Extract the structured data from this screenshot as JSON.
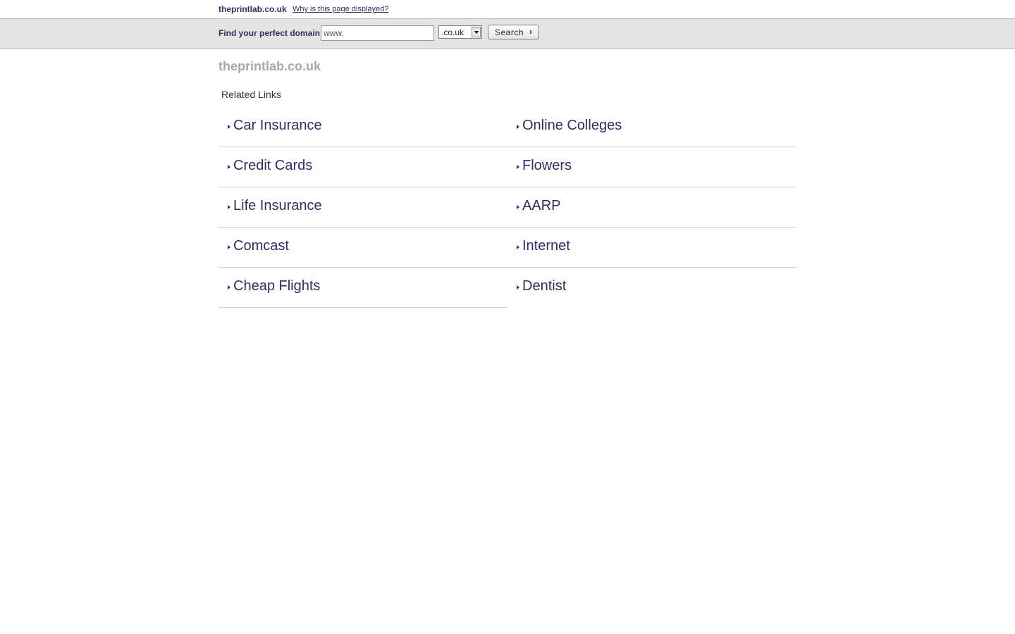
{
  "top_bar": {
    "site_name": "theprintlab.co.uk",
    "why_link": "Why is this page displayed?"
  },
  "search_bar": {
    "label": "Find your perfect domain",
    "input_value": "www.",
    "tld_selected": ".co.uk",
    "search_button": "Search"
  },
  "main": {
    "domain_title": "theprintlab.co.uk",
    "related_links_title": "Related Links",
    "links_left": [
      "Car Insurance",
      "Credit Cards",
      "Life Insurance",
      "Comcast",
      "Cheap Flights"
    ],
    "links_right": [
      "Online Colleges",
      "Flowers",
      "AARP",
      "Internet",
      "Dentist"
    ]
  },
  "colors": {
    "link": "#2e2f5e",
    "title_gray": "#a8a8a8",
    "search_bar_bg": "#e4e4e4",
    "divider": "#cfcfcf"
  },
  "icons": {
    "link_bullet": "triangle-right-icon",
    "dropdown": "chevron-down-icon",
    "search_arrow": "chevron-right-icon"
  }
}
